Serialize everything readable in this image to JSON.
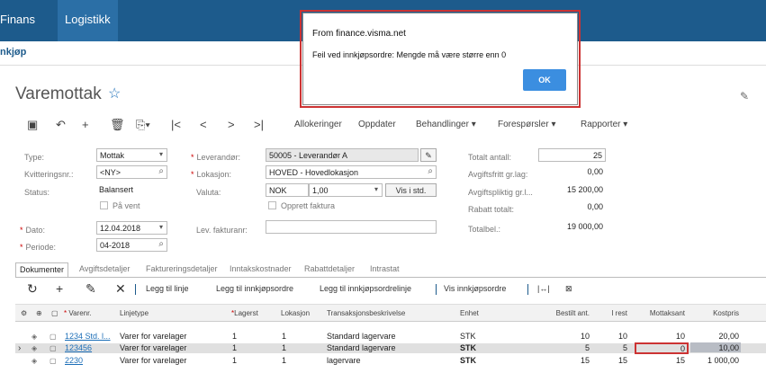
{
  "topnav": {
    "finans": "Finans",
    "logistikk": "Logistikk"
  },
  "breadcrumb": "nkjøp",
  "page_title": "Varemottak",
  "toolbar": {
    "allokeringer": "Allokeringer",
    "oppdater": "Oppdater",
    "behandlinger": "Behandlinger",
    "foresporsler": "Forespørsler",
    "rapporter": "Rapporter"
  },
  "form": {
    "type_label": "Type:",
    "type_value": "Mottak",
    "kvittering_label": "Kvitteringsnr.:",
    "kvittering_value": "<NY>",
    "status_label": "Status:",
    "status_value": "Balansert",
    "pa_vent": "På vent",
    "dato_label": "Dato:",
    "dato_value": "12.04.2018",
    "periode_label": "Periode:",
    "periode_value": "04-2018",
    "leverandor_label": "Leverandør:",
    "leverandor_value": "50005 - Leverandør A",
    "lokasjon_label": "Lokasjon:",
    "lokasjon_value": "HOVED - Hovedlokasjon",
    "valuta_label": "Valuta:",
    "valuta_code": "NOK",
    "valuta_rate": "1,00",
    "vis_i_std": "Vis i std.",
    "opprett_faktura": "Opprett faktura",
    "lev_fakturanr_label": "Lev. fakturanr:",
    "lev_fakturanr_value": "",
    "totalt_antall_label": "Totalt antall:",
    "totalt_antall_value": "25",
    "avgiftsfritt_label": "Avgiftsfritt gr.lag:",
    "avgiftsfritt_value": "0,00",
    "avgiftspliktig_label": "Avgiftspliktig gr.l...",
    "avgiftspliktig_value": "15 200,00",
    "rabatt_label": "Rabatt totalt:",
    "rabatt_value": "0,00",
    "totalbel_label": "Totalbel.:",
    "totalbel_value": "19 000,00"
  },
  "tabs": [
    "Dokumenter",
    "Avgiftsdetaljer",
    "Faktureringsdetaljer",
    "Inntakskostnader",
    "Rabattdetaljer",
    "Intrastat"
  ],
  "grid_toolbar": {
    "legg_til_linje": "Legg til linje",
    "legg_til_innkjopsordre": "Legg til innkjøpsordre",
    "legg_til_innkjopsordrelinje": "Legg til innkjøpsordrelinje",
    "vis_innkjopsordre": "Vis innkjøpsordre"
  },
  "grid": {
    "columns": [
      "Varenr.",
      "Linjetype",
      "Lagerst",
      "Lokasjon",
      "Transaksjonsbeskrivelse",
      "Enhet",
      "Bestilt ant.",
      "I rest",
      "Mottaksant",
      "Kostpris"
    ],
    "rows": [
      [
        "1234 Std. l...",
        "Varer for varelager",
        "1",
        "1",
        "Standard lagervare",
        "STK",
        "10",
        "10",
        "10",
        "20,00"
      ],
      [
        "123456",
        "Varer for varelager",
        "1",
        "1",
        "Standard lagervare",
        "STK",
        "5",
        "5",
        "0",
        "10,00"
      ],
      [
        "2230",
        "Varer for varelager",
        "1",
        "1",
        "lagervare",
        "STK",
        "15",
        "15",
        "15",
        "1 000,00"
      ]
    ]
  },
  "dialog": {
    "title": "From finance.visma.net",
    "message": "Feil ved innkjøpsordre: Mengde må være større enn 0",
    "ok": "OK"
  },
  "colors": {
    "topbar": "#1d5b8c",
    "accent": "#1d6fb8",
    "error_outline": "#cc3333",
    "ok_button": "#3b8ee0"
  }
}
